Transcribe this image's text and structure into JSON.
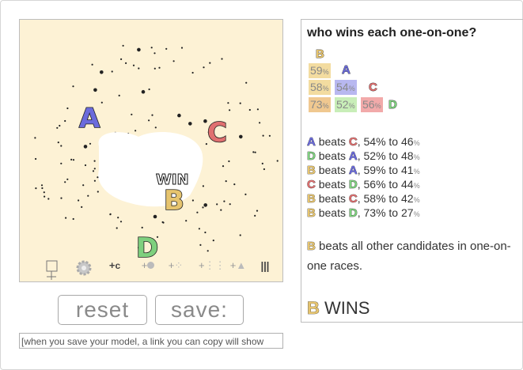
{
  "candidates": [
    {
      "letter": "A",
      "color": "#6b6bdc"
    },
    {
      "letter": "B",
      "color": "#e6c46e"
    },
    {
      "letter": "C",
      "color": "#e07070"
    },
    {
      "letter": "D",
      "color": "#7ed07e"
    }
  ],
  "canvas": {
    "win_label": "WIN"
  },
  "toolbar": {
    "icons": [
      "voter-tool-icon",
      "gear-icon",
      "add-candidate-icon",
      "add-voter-icon",
      "add-voter-group-icon",
      "add-voter-grid-icon",
      "add-triangle-icon",
      "columns-icon"
    ]
  },
  "buttons": {
    "reset": "reset",
    "save": "save:"
  },
  "link_box": {
    "text": "[when you save your model, a link you can copy will show"
  },
  "panel": {
    "title": "who wins each one-on-one?",
    "matrix": {
      "row_b": "B",
      "row_a": {
        "cell": "59",
        "pct": "%",
        "letter": "A"
      },
      "row_c": {
        "cells": [
          "58",
          "54"
        ],
        "pct": "%",
        "letter": "C"
      },
      "row_d": {
        "cells": [
          "73",
          "52",
          "56"
        ],
        "pct": "%",
        "letter": "D"
      }
    },
    "results": [
      {
        "w": "A",
        "l": "C",
        "text": ", 54",
        "t2": "% to 46",
        "pct": "%"
      },
      {
        "w": "D",
        "l": "A",
        "text": ", 52",
        "t2": "% to 48",
        "pct": "%"
      },
      {
        "w": "B",
        "l": "A",
        "text": ", 59",
        "t2": "% to 41",
        "pct": "%"
      },
      {
        "w": "C",
        "l": "D",
        "text": ", 56",
        "t2": "% to 44",
        "pct": "%"
      },
      {
        "w": "B",
        "l": "C",
        "text": ", 58",
        "t2": "% to 42",
        "pct": "%"
      },
      {
        "w": "B",
        "l": "D",
        "text": ", 73",
        "t2": "% to 27",
        "pct": "%"
      }
    ],
    "beats_word": "beats",
    "summary_text": "beats all other candidates in one-on-one races.",
    "summary_letter": "B",
    "winner_letter": "B",
    "winner_text": "WINS"
  }
}
